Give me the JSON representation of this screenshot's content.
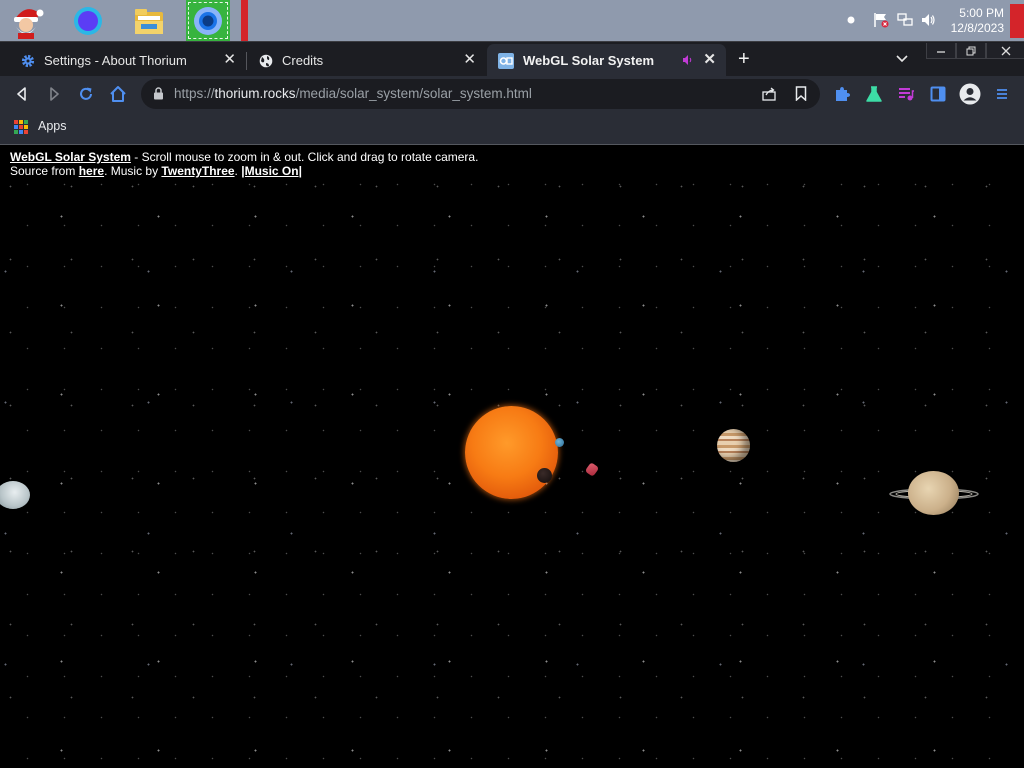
{
  "taskbar": {
    "apps": [
      {
        "name": "santa-app-icon"
      },
      {
        "name": "circle-app-icon"
      },
      {
        "name": "file-explorer-icon"
      },
      {
        "name": "thorium-browser-icon"
      }
    ],
    "clock": {
      "time": "5:00 PM",
      "date": "12/8/2023"
    }
  },
  "tabs": [
    {
      "title": "Settings - About Thorium",
      "icon": "gear-icon"
    },
    {
      "title": "Credits",
      "icon": "globe-icon"
    },
    {
      "title": "WebGL Solar System",
      "icon": "webgl-icon",
      "audio": true
    }
  ],
  "toolbar": {
    "url_scheme": "https://",
    "url_host": "thorium.rocks",
    "url_path": "/media/solar_system/solar_system.html"
  },
  "bookmarks": {
    "apps_label": "Apps"
  },
  "page": {
    "title_link": "WebGL Solar System",
    "line1_text": " - Scroll mouse to zoom in & out. Click and drag to rotate camera.",
    "line2_prefix": "Source from ",
    "source_link": "here",
    "line2_mid": ". Music by ",
    "music_link": "TwentyThree",
    "line2_sep": ". ",
    "music_toggle": "|Music On|"
  },
  "colors": {
    "taskbar": "#8f9aad",
    "tabstrip": "#1c1d22",
    "toolbar": "#2a2d36",
    "accent_blue": "#4f8ff0",
    "sun": "#f26b0c"
  }
}
